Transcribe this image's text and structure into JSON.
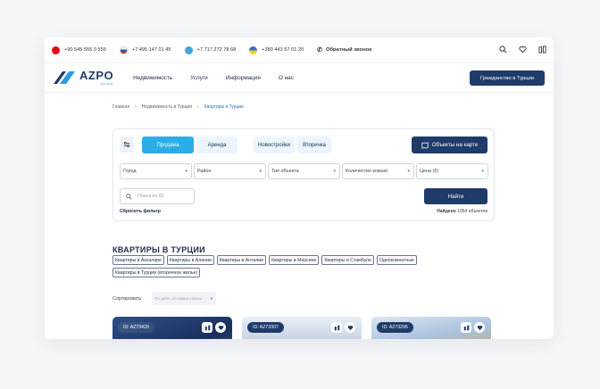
{
  "topbar": {
    "phones": [
      {
        "flag": "tr",
        "number": "+90 545 555 0 555"
      },
      {
        "flag": "ru",
        "number": "+7 495 147 01 45"
      },
      {
        "flag": "kz",
        "number": "+7 717 272 78 68"
      },
      {
        "flag": "ua",
        "number": "+380 443 57 01 20"
      }
    ],
    "callback_label": "Обратный звонок"
  },
  "navbar": {
    "logo_text": "AZPO",
    "logo_sub": "estate",
    "items": [
      "Недвижимость",
      "Услуги",
      "Информация",
      "О нас"
    ],
    "cta_label": "Гражданство в Турции"
  },
  "breadcrumb": [
    "Главная",
    "Недвижимость в Турции",
    "Квартиры в Турции"
  ],
  "filter": {
    "tabs": [
      "Продажа",
      "Аренда",
      "Новостройки",
      "Вторичка"
    ],
    "map_button": "Объекты на карте",
    "selects": [
      "Город",
      "Район",
      "Тип объекта",
      "Количество комнат",
      "Цена (€)"
    ],
    "id_placeholder": "Поиск по ID",
    "reset_label": "Сбросить фильтр",
    "find_label": "Найти",
    "found_prefix": "Найдено",
    "found_count": "1954",
    "found_suffix": "объектов"
  },
  "section_title": "КВАРТИРЫ В ТУРЦИИ",
  "tags": [
    "Квартиры в Аксаларе",
    "Квартиры в Алании",
    "Квартиры в Анталии",
    "Квартиры в Мерсине",
    "Квартиры в Стамбуле",
    "Однокомнатные",
    "Квартиры в Турции (вторичное жилье)"
  ],
  "sort": {
    "label": "Сортировать:",
    "value": "По дате: от самых новых"
  },
  "cards": [
    {
      "id": "ID: AZ73429"
    },
    {
      "id": "ID: AZ73307"
    },
    {
      "id": "ID: AZ73295"
    }
  ],
  "colors": {
    "primary": "#1f3b69",
    "accent": "#2baee8"
  }
}
